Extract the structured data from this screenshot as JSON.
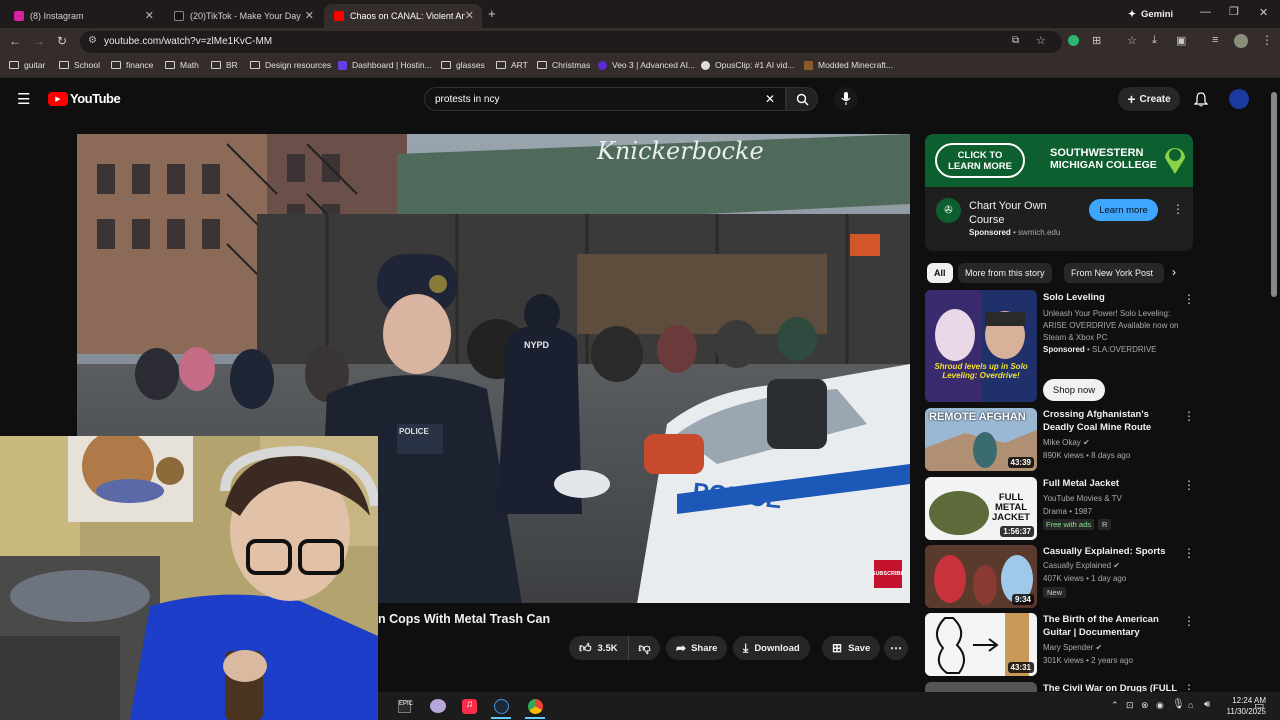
{
  "browser": {
    "tabs": [
      {
        "label": "(8) Instagram",
        "color": "#d6249f"
      },
      {
        "label": "(20)TikTok - Make Your Day",
        "color": "#111111"
      },
      {
        "label": "Chaos on CANAL: Violent Anti-",
        "color": "#ff0000"
      }
    ],
    "gemini_label": "Gemini",
    "url": "youtube.com/watch?v=zlMe1KvC-MM",
    "bookmarks": [
      "guitar",
      "School",
      "finance",
      "Math",
      "BR",
      "Design resources",
      "Dashboard | Hostin...",
      "glasses",
      "ART",
      "Christmas",
      "Veo 3 | Advanced AI...",
      "OpusClip: #1 AI vid...",
      "Modded Minecraft..."
    ]
  },
  "youtube": {
    "logo_text": "YouTube",
    "search_value": "protests in ncy",
    "create_label": "Create"
  },
  "video": {
    "title_partial": "n Cops With Metal Trash Can",
    "banner_text": "Knickerbocke",
    "badge_text": "POLICE",
    "car_text": "POLICE",
    "subscribe_text": "SUBSCRIBE",
    "nypd_text": "NYPD",
    "like_count": "3.5K",
    "share_label": "Share",
    "download_label": "Download",
    "save_label": "Save"
  },
  "ad": {
    "banner_cta": "CLICK TO LEARN MORE",
    "banner_school_line1": "SOUTHWESTERN",
    "banner_school_line2": "MICHIGAN COLLEGE",
    "title": "Chart Your Own Course",
    "sponsored": "Sponsored",
    "domain": "swmich.edu",
    "learn_more": "Learn more"
  },
  "chips": [
    "All",
    "More from this story",
    "From New York Post"
  ],
  "recommendations": [
    {
      "title": "Solo Leveling",
      "meta1": "Unleash Your Power! Solo Leveling:",
      "meta2": "ARISE OVERDRIVE Available now on",
      "meta3": "Steam & Xbox PC",
      "sponsored": "Sponsored",
      "advertiser": "SLA:OVERDRIVE",
      "cta": "Shop now",
      "thumb_text": "Shroud levels up in Solo Leveling: Overdrive!"
    },
    {
      "title": "Crossing Afghanistan's Deadly Coal Mine Route",
      "channel": "Mike Okay",
      "stats": "890K views • 8 days ago",
      "duration": "43:39",
      "thumb_text": "REMOTE AFGHAN"
    },
    {
      "title": "Full Metal Jacket",
      "channel": "YouTube Movies & TV",
      "stats": "Drama • 1987",
      "free": "Free with ads",
      "rating": "R",
      "duration": "1:56:37",
      "thumb_text": "FULL METAL JACKET"
    },
    {
      "title": "Casually Explained: Sports",
      "channel": "Casually Explained",
      "stats": "407K views • 1 day ago",
      "badge": "New",
      "duration": "9:34"
    },
    {
      "title": "The Birth of the American Guitar | Documentary",
      "channel": "Mary Spender",
      "stats": "301K views • 2 years ago",
      "duration": "43:31"
    },
    {
      "title": "The Civil War on Drugs (FULL"
    }
  ],
  "taskbar": {
    "time": "12:24 AM",
    "date": "11/30/2025"
  }
}
